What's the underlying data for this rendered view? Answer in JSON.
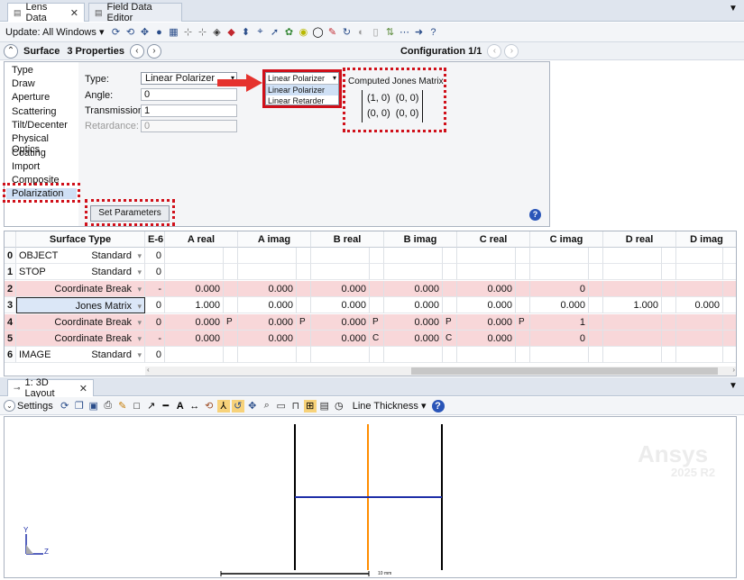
{
  "tabs": [
    {
      "label": "Lens Data",
      "active": true
    },
    {
      "label": "Field Data Editor",
      "active": false
    }
  ],
  "toolbar": {
    "update_label": "Update: All Windows"
  },
  "surface_bar": {
    "surface_label": "Surface",
    "properties_label": "3 Properties",
    "configuration_label": "Configuration 1/1"
  },
  "sidebar": {
    "items": [
      "Type",
      "Draw",
      "Aperture",
      "Scattering",
      "Tilt/Decenter",
      "Physical Optics",
      "Coating",
      "Import",
      "Composite",
      "Polarization"
    ],
    "selected": "Polarization"
  },
  "form": {
    "type_label": "Type:",
    "type_value": "Linear Polarizer",
    "angle_label": "Angle:",
    "angle_value": "0",
    "transmission_label": "Transmission:",
    "transmission_value": "1",
    "retardance_label": "Retardance:",
    "retardance_value": "0",
    "set_params_label": "Set Parameters"
  },
  "dropdown": {
    "selected": "Linear Polarizer",
    "options": [
      "Linear Polarizer",
      "Linear Retarder"
    ]
  },
  "jones": {
    "title": "Computed Jones Matrix",
    "row1": "(1, 0)  (0, 0)",
    "row2": "(0, 0)  (0, 0)"
  },
  "table": {
    "headers": [
      "Surface Type",
      "E-6",
      "A real",
      "A imag",
      "B real",
      "B imag",
      "C real",
      "C imag",
      "D real",
      "D imag"
    ],
    "rows": [
      {
        "num": "0",
        "name": "OBJECT",
        "type": "Standard",
        "e6": "0",
        "vals": [
          "",
          "",
          "",
          "",
          "",
          "",
          "",
          "",
          "",
          "",
          "",
          "",
          "",
          "",
          "",
          ""
        ],
        "pink": false
      },
      {
        "num": "1",
        "name": "STOP",
        "type": "Standard",
        "e6": "0",
        "vals": [
          "",
          "",
          "",
          "",
          "",
          "",
          "",
          "",
          "",
          "",
          "",
          "",
          "",
          "",
          "",
          ""
        ],
        "pink": false
      },
      {
        "num": "2",
        "name": "",
        "type": "Coordinate Break",
        "e6": "-",
        "vals": [
          "0.000",
          "",
          "0.000",
          "",
          "0.000",
          "",
          "0.000",
          "",
          "0.000",
          "",
          "0",
          "",
          "",
          "",
          "",
          ""
        ],
        "pink": true
      },
      {
        "num": "3",
        "name": "",
        "type": "Jones Matrix",
        "e6": "0",
        "vals": [
          "1.000",
          "",
          "0.000",
          "",
          "0.000",
          "",
          "0.000",
          "",
          "0.000",
          "",
          "0.000",
          "",
          "1.000",
          "",
          "0.000",
          ""
        ],
        "pink": false
      },
      {
        "num": "4",
        "name": "",
        "type": "Coordinate Break",
        "e6": "0",
        "vals": [
          "0.000",
          "P",
          "0.000",
          "P",
          "0.000",
          "P",
          "0.000",
          "P",
          "0.000",
          "P",
          "1",
          "",
          "",
          "",
          "",
          ""
        ],
        "pink": true
      },
      {
        "num": "5",
        "name": "",
        "type": "Coordinate Break",
        "e6": "-",
        "vals": [
          "0.000",
          "",
          "0.000",
          "",
          "0.000",
          "C",
          "0.000",
          "C",
          "0.000",
          "",
          "0",
          "",
          "",
          "",
          "",
          ""
        ],
        "pink": true
      },
      {
        "num": "6",
        "name": "IMAGE",
        "type": "Standard",
        "e6": "0",
        "vals": [
          "",
          "",
          "",
          "",
          "",
          "",
          "",
          "",
          "",
          "",
          "",
          "",
          "",
          "",
          "",
          ""
        ],
        "pink": false
      }
    ]
  },
  "layout": {
    "tab_label": "1: 3D Layout",
    "settings_label": "Settings",
    "line_thickness_label": "Line Thickness",
    "watermark_brand": "Ansys",
    "watermark_version": "2025 R2",
    "scale_label": "10 mm",
    "axis_y": "Y",
    "axis_z": "Z",
    "colors": {
      "lens": "#000000",
      "ray": "#1f2fa8",
      "surface": "#ff8c00"
    }
  }
}
